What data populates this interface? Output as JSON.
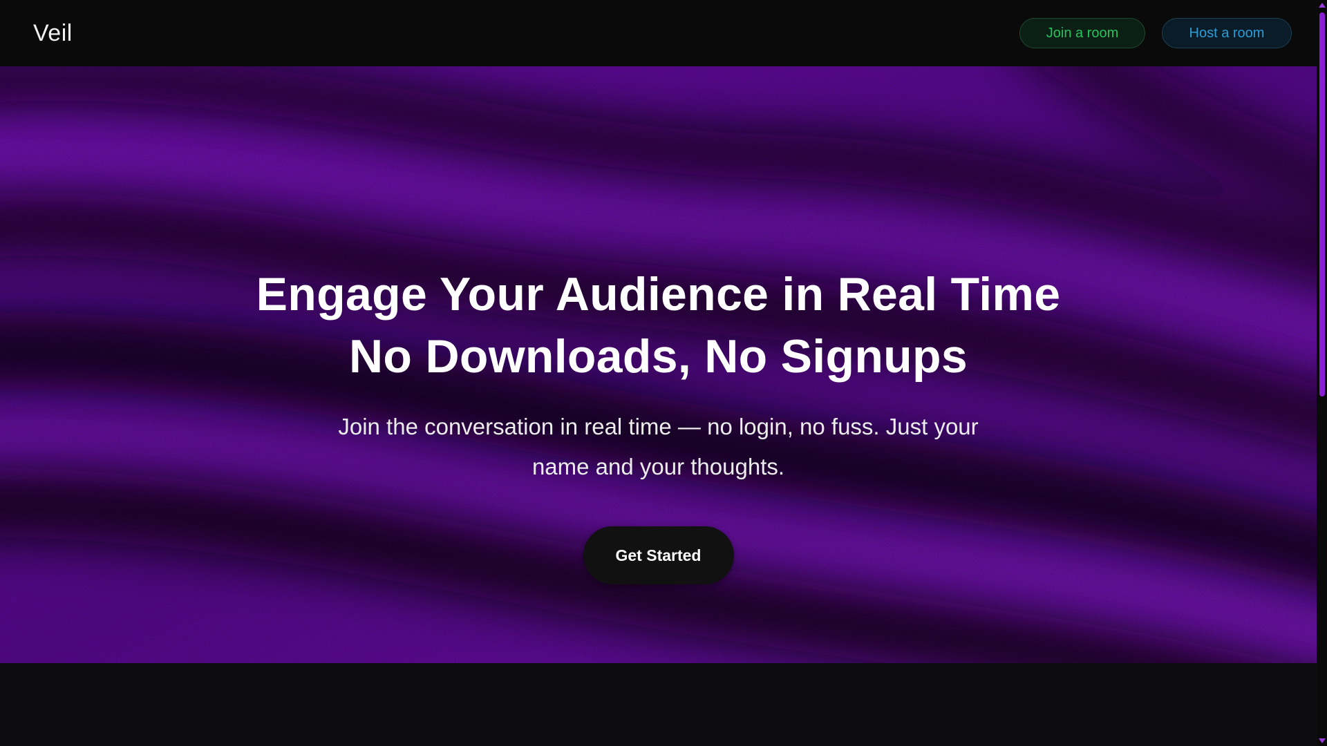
{
  "header": {
    "brand": "Veil",
    "join_label": "Join a room",
    "host_label": "Host a room"
  },
  "hero": {
    "headline_line1": "Engage Your Audience in Real Time",
    "headline_line2": "No Downloads, No Signups",
    "subtitle": "Join the conversation in real time — no login, no fuss. Just your name and your thoughts.",
    "cta_label": "Get Started"
  },
  "colors": {
    "accent_purple": "#6a0ba6",
    "join_green": "#25c25e",
    "host_blue": "#2c9bd6",
    "scrollbar_thumb": "#8a1ed6"
  },
  "icons": {
    "scroll_up": "chevron-up-icon",
    "scroll_down": "chevron-down-icon"
  }
}
